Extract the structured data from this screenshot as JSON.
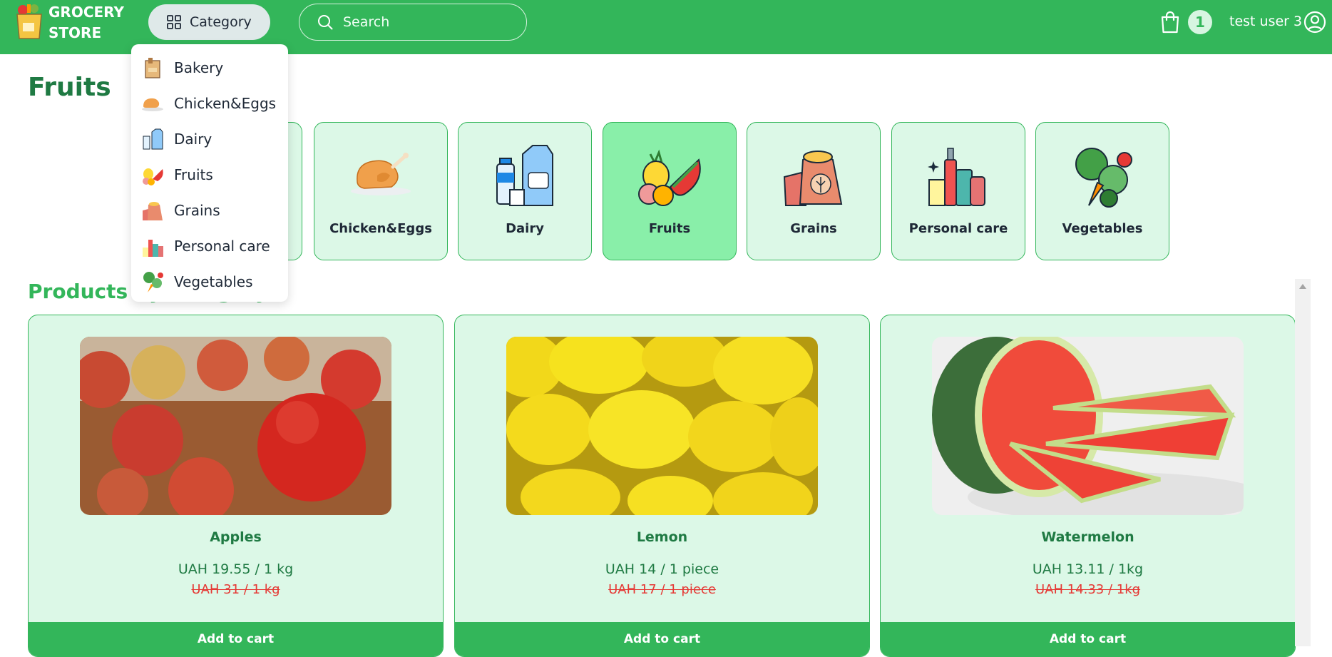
{
  "header": {
    "logo_line1": "GROCERY",
    "logo_line2": "STORE",
    "category_label": "Category",
    "search_placeholder": "Search",
    "cart_count": "1",
    "username": "test user 3"
  },
  "page_title": "Fruits",
  "dropdown": {
    "items": [
      {
        "label": "Bakery",
        "icon": "bread-bag-icon"
      },
      {
        "label": "Chicken&Eggs",
        "icon": "roast-chicken-icon"
      },
      {
        "label": "Dairy",
        "icon": "milk-carton-icon"
      },
      {
        "label": "Fruits",
        "icon": "fruits-icon"
      },
      {
        "label": "Grains",
        "icon": "grain-sack-icon"
      },
      {
        "label": "Personal care",
        "icon": "toiletries-icon"
      },
      {
        "label": "Vegetables",
        "icon": "vegetables-icon"
      }
    ]
  },
  "categories": {
    "items": [
      {
        "label": "Chicken&Eggs",
        "icon": "roast-chicken-icon"
      },
      {
        "label": "Dairy",
        "icon": "milk-carton-icon"
      },
      {
        "label": "Fruits",
        "icon": "fruits-icon",
        "active": true
      },
      {
        "label": "Grains",
        "icon": "grain-sack-icon"
      },
      {
        "label": "Personal care",
        "icon": "toiletries-icon"
      },
      {
        "label": "Vegetables",
        "icon": "vegetables-icon"
      }
    ]
  },
  "section_title": "Products by category",
  "products": [
    {
      "name": "Apples",
      "price": "UAH 19.55 / 1 kg",
      "old_price": "UAH 31 / 1 kg",
      "button": "Add to cart",
      "image": "apples-photo"
    },
    {
      "name": "Lemon",
      "price": "UAH 14 / 1 piece",
      "old_price": "UAH 17 / 1 piece",
      "button": "Add to cart",
      "image": "lemons-photo"
    },
    {
      "name": "Watermelon",
      "price": "UAH 13.11 / 1kg",
      "old_price": "UAH 14.33 / 1kg",
      "button": "Add to cart",
      "image": "watermelon-photo"
    }
  ],
  "colors": {
    "brand_green": "#33b65a",
    "card_bg": "#dcf8e7",
    "active_card_bg": "#89efa9",
    "old_price_red": "#e53935"
  }
}
